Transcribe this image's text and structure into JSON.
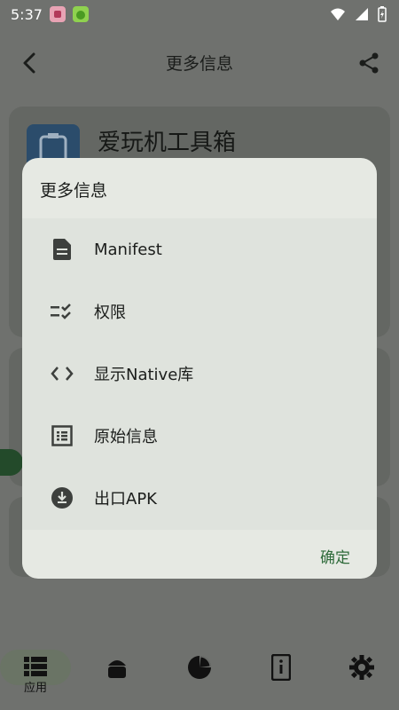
{
  "status_bar": {
    "time": "5:37"
  },
  "top_bar": {
    "title": "更多信息"
  },
  "app": {
    "name": "爱玩机工具箱"
  },
  "dialog": {
    "title": "更多信息",
    "items": [
      {
        "label": "Manifest",
        "icon": "document-icon"
      },
      {
        "label": "权限",
        "icon": "checklist-icon"
      },
      {
        "label": "显示Native库",
        "icon": "code-icon"
      },
      {
        "label": "原始信息",
        "icon": "list-box-icon"
      },
      {
        "label": "出口APK",
        "icon": "download-circle-icon"
      }
    ],
    "confirm_label": "确定"
  },
  "bottom_nav": {
    "items": [
      {
        "label": "应用",
        "icon": "apps-list-icon",
        "active": true
      },
      {
        "label": "",
        "icon": "android-icon"
      },
      {
        "label": "",
        "icon": "pie-chart-icon"
      },
      {
        "label": "",
        "icon": "device-info-icon"
      },
      {
        "label": "",
        "icon": "gear-icon"
      }
    ]
  },
  "colors": {
    "scrim_background": "#6f716e",
    "dialog_background": "#e6e9e3",
    "accent_green": "#2f6b3b"
  }
}
